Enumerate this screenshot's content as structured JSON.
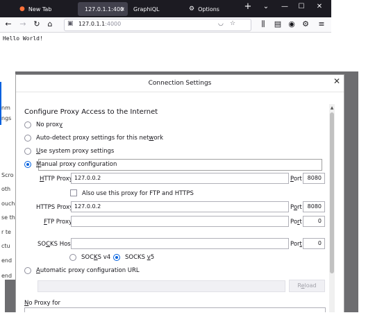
{
  "browser": {
    "tabs": [
      {
        "label": "New Tab",
        "icon": "firefox-icon"
      },
      {
        "label": "127.0.1.1:400",
        "icon": ""
      },
      {
        "label": "GraphiQL",
        "icon": ""
      },
      {
        "label": "Options",
        "icon": "gear-icon"
      }
    ],
    "new_tab": "+",
    "window_controls": {
      "dropdown": "⌄",
      "minimize": "—",
      "maximize": "☐",
      "close": "✕"
    },
    "url_host": "127.0.1.1",
    "url_port": ":4000",
    "page_text": "Hello World!"
  },
  "background_page": {
    "fragments": [
      "nm",
      "ngs",
      "",
      "",
      "",
      "Scro",
      "oth",
      "ouch",
      "se th",
      "r te",
      "ctu",
      "end",
      "end"
    ]
  },
  "dialog": {
    "title": "Connection Settings",
    "close": "✕",
    "heading": "Configure Proxy Access to the Internet",
    "options": {
      "no_proxy": {
        "pre": "No prox",
        "u": "y",
        "post": ""
      },
      "auto_detect": {
        "pre": "Auto-detect proxy settings for this net",
        "u": "w",
        "post": "ork"
      },
      "system": {
        "pre": "",
        "u": "U",
        "post": "se system proxy settings"
      },
      "manual": {
        "pre": "",
        "u": "M",
        "post": "anual proxy configuration"
      },
      "auto_url": {
        "pre": "",
        "u": "A",
        "post": "utomatic proxy configuration URL"
      }
    },
    "http": {
      "label_pre": "",
      "label_u": "H",
      "label_post": "TTP Proxy",
      "value": "127.0.0.2",
      "port_pre": "",
      "port_u": "P",
      "port_post": "ort",
      "port": "8080"
    },
    "also_use": "Also use this proxy for FTP and HTTPS",
    "https": {
      "label": "HTTPS Proxy",
      "value": "127.0.0.2",
      "port_pre": "P",
      "port_u": "o",
      "port_post": "rt",
      "port": "8080"
    },
    "ftp": {
      "label_pre": "",
      "label_u": "F",
      "label_post": "TP Proxy",
      "value": "",
      "port_pre": "Po",
      "port_u": "r",
      "port_post": "t",
      "port": "0"
    },
    "socks": {
      "label_pre": "SO",
      "label_u": "C",
      "label_post": "KS Host",
      "value": "",
      "port_pre": "Por",
      "port_u": "t",
      "port_post": "",
      "port": "0"
    },
    "socks_v4": {
      "pre": "SOC",
      "u": "K",
      "post": "S v4"
    },
    "socks_v5": {
      "pre": "SOCKS ",
      "u": "v",
      "post": "5"
    },
    "reload": {
      "pre": "R",
      "u": "e",
      "post": "load"
    },
    "no_proxy_for": {
      "pre": "",
      "u": "N",
      "post": "o Proxy for"
    },
    "selected_option": "manual",
    "selected_socks": "v5"
  },
  "colors": {
    "accent": "#0060df",
    "tabbar": "#1c1b22",
    "overlay": "#6d6d70"
  }
}
